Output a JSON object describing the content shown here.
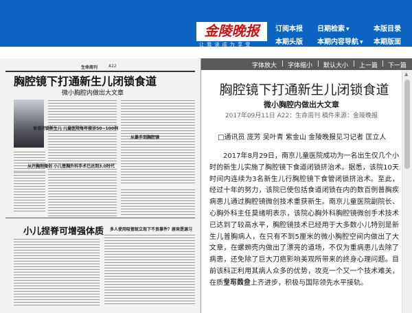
{
  "header": {
    "logo": "金陵晚报",
    "slogan": "让 我 读 成 为 享 受",
    "nav_row1": [
      "订阅本报",
      "日期检索",
      "本版目录"
    ],
    "nav_row2": [
      "本期头版",
      "本期内容导航",
      "本期版面"
    ]
  },
  "newspaper": {
    "top_left": "生命周刊",
    "page": "A22",
    "title": "胸腔镜下打通新生儿闭锁食道",
    "subtitle": "微小胸腔内做出大文章",
    "caption": "食道闭锁新生儿  儿童医院每年接诊50~100例",
    "side_head": "从暴手到胸腔镜",
    "side_head2": "从开胸到微创  小儿普胸外科手术已达到3.0时代",
    "bottom_title": "小儿捏脊可增强体质",
    "bottom_head2": "多人使用吸管就立现下不良事件？原来是源习"
  },
  "toolbar": {
    "items": [
      "字体放大",
      "字体缩小",
      "默认大小",
      "上一篇",
      "下一篇"
    ],
    "separator": "|"
  },
  "article": {
    "title": "胸腔镜下打通新生儿闭锁食道",
    "subtitle": "微小胸腔内做出大文章",
    "meta": "2017年09月11日   A22：生命周刊   稿件来源：金陵晚报",
    "byline": "□通讯员  庞芳  吴叶青  紫金山 金陵晚报见习记者  匡立人",
    "body": "2017年8月29日，南京儿童医院成功为一名出生仅几个小时的新生儿实施了胸腔镜下食道闭锁挤治术。据悉，该院10天时间内连续为3名新生儿行胸腔镜下食管闭锁挤治术。至此，经过十年的努力，该院已使包括食道闭锁在内的数百例普胸疾病患儿通过胸腔镜微创技术重获新生。南京儿童医院副院长、心胸外科主任莫绪明表示，该院心胸外科胸腔镜微创手术技术已达到了较高水平，胸腔镜技术已经用于大多数小儿特别是新生儿普胸病人，在只有不到5厘米的微小胸腔空间内做出了大文章，在螺蛳壳内做出了漂亮的道场，不仅为重病患儿去除了病患，还免除了巨大刀疤影响美观所带来的终身心理问题。目前该科正利用其病人众多的优势，攻克一个又一个技术难关，在质量与数量上齐进步，积极与国际领先水平接轨。",
    "expert": "专家简介"
  }
}
